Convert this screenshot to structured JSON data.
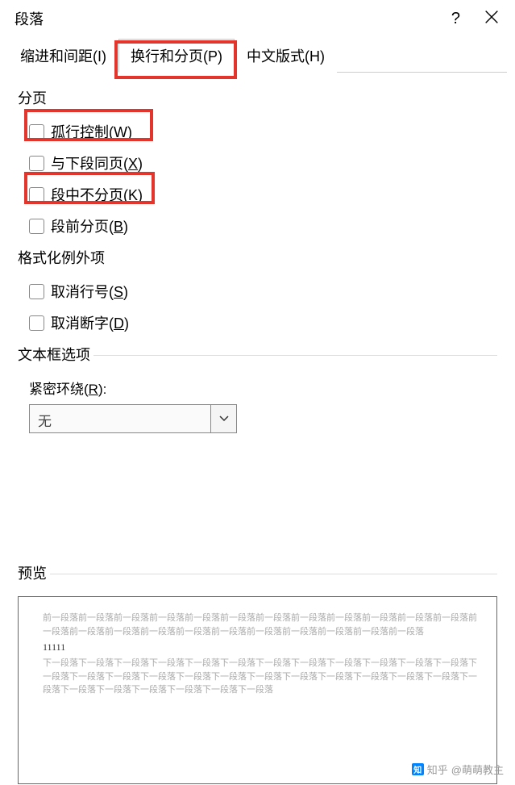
{
  "dialog": {
    "title": "段落",
    "help": "?",
    "close": "×"
  },
  "tabs": {
    "t1": "缩进和间距(I)",
    "t2": "换行和分页(P)",
    "t3": "中文版式(H)"
  },
  "sections": {
    "pagination": "分页",
    "formatting_exceptions": "格式化例外项",
    "textbox_options": "文本框选项",
    "preview": "预览"
  },
  "checkboxes": {
    "widow": {
      "label": "孤行控制(",
      "hotkey": "W",
      "suffix": ")"
    },
    "keep_next": {
      "label": "与下段同页(",
      "hotkey": "X",
      "suffix": ")"
    },
    "keep_lines": {
      "label": "段中不分页(",
      "hotkey": "K",
      "suffix": ")"
    },
    "page_break": {
      "label": "段前分页(",
      "hotkey": "B",
      "suffix": ")"
    },
    "suppress_line": {
      "label": "取消行号(",
      "hotkey": "S",
      "suffix": ")"
    },
    "no_hyphen": {
      "label": "取消断字(",
      "hotkey": "D",
      "suffix": ")"
    }
  },
  "tight_wrap": {
    "label": "紧密环绕(",
    "hotkey": "R",
    "suffix": "):",
    "value": "无"
  },
  "preview_text": {
    "before": "前一段落前一段落前一段落前一段落前一段落前一段落前一段落前一段落前一段落前一段落前一段落前一段落前一段落前一段落前一段落前一段落前一段落前一段落前一段落前一段落前一段落前一段落前一段落",
    "sample": "11111",
    "after": "下一段落下一段落下一段落下一段落下一段落下一段落下一段落下一段落下一段落下一段落下一段落下一段落下一段落下一段落下一段落下一段落下一段落下一段落下一段落下一段落下一段落下一段落下一段落下一段落下一段落下一段落下一段落下一段落下一段落下一段落下一段落"
  },
  "watermark": {
    "brand": "知乎",
    "user": "@萌萌教主"
  }
}
